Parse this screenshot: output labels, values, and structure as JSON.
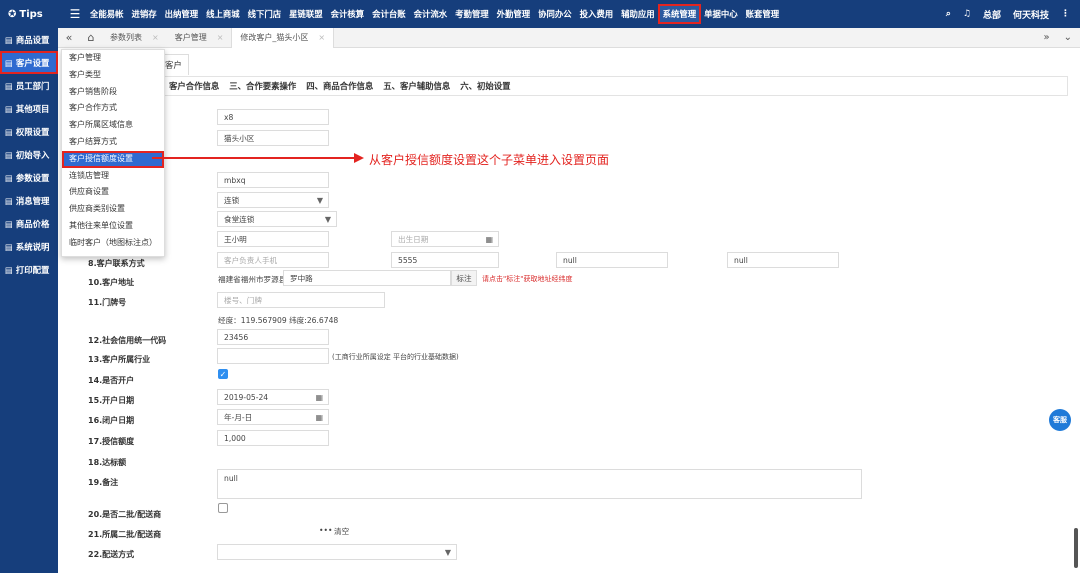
{
  "topbar": {
    "logo": "Tips",
    "menus": [
      "全能易帐",
      "进销存",
      "出纳管理",
      "线上商城",
      "线下门店",
      "星链联盟",
      "会计核算",
      "会计台账",
      "会计流水",
      "考勤管理",
      "外勤管理",
      "协同办公",
      "投入费用",
      "辅助应用",
      "系统管理",
      "单据中心",
      "账套管理"
    ],
    "active_menu": "系统管理",
    "right_user1": "总部",
    "right_user2": "何天科技"
  },
  "sidebar": {
    "items": [
      "商品设置",
      "客户设置",
      "员工部门",
      "其他项目",
      "权限设置",
      "初始导入",
      "参数设置",
      "消息管理",
      "商品价格",
      "系统说明",
      "打印配置"
    ],
    "active": "客户设置"
  },
  "tabs": {
    "items": [
      "参数列表",
      "客户管理",
      "修改客户_猫头小区"
    ],
    "active": "修改客户_猫头小区"
  },
  "subtab": "客户",
  "sections": [
    "客户合作信息",
    "三、合作要素操作",
    "四、商品合作信息",
    "五、客户辅助信息",
    "六、初始设置"
  ],
  "dropdown": {
    "items": [
      "客户管理",
      "客户类型",
      "客户销售阶段",
      "客户合作方式",
      "客户所属区域信息",
      "客户结算方式",
      "客户授信额度设置",
      "连锁店管理",
      "供应商设置",
      "供应商类别设置",
      "其他往来单位设置",
      "临时客户（地图标注点）"
    ],
    "highlighted": "客户授信额度设置"
  },
  "annotation": "从客户授信额度设置这个子菜单进入设置页面",
  "form": {
    "code": "x8",
    "name": "猫头小区",
    "pinyin": "mbxq",
    "type_select": "连锁",
    "chain_select": "食堂连锁",
    "contact_name": "王小明",
    "birthday_placeholder": "出生日期",
    "l8": "8.客户联系方式",
    "phone_placeholder": "客户负责人手机",
    "phone2": "5555",
    "null1": "null",
    "null2": "null",
    "l10": "10.客户地址",
    "address1": "福建省福州市罗源县",
    "address2": "罗中路",
    "mark_btn": "标注",
    "mark_hint": "请点击\"标注\"获取地址经纬度",
    "l11": "11.门牌号",
    "door_placeholder": "楼号、门牌",
    "coords": "经度：119.567909   纬度:26.6748",
    "l12": "12.社会信用统一代码",
    "credit_code": "23456",
    "l13": "13.客户所属行业",
    "industry_hint": "(工商行业所属设定 平台的行业基础数据)",
    "l14": "14.是否开户",
    "l15": "15.开户日期",
    "open_date": "2019-05-24",
    "l16": "16.闭户日期",
    "close_date_placeholder": "年-月-日",
    "l17": "17.授信额度",
    "credit_limit": "1,000",
    "l18": "18.达标额",
    "l19": "19.备注",
    "remark": "null",
    "l20": "20.是否二批/配送商",
    "l21": "21.所属二批/配送商",
    "dots": "•••",
    "clear": "清空",
    "l22": "22.配送方式"
  },
  "service_label": "客服"
}
